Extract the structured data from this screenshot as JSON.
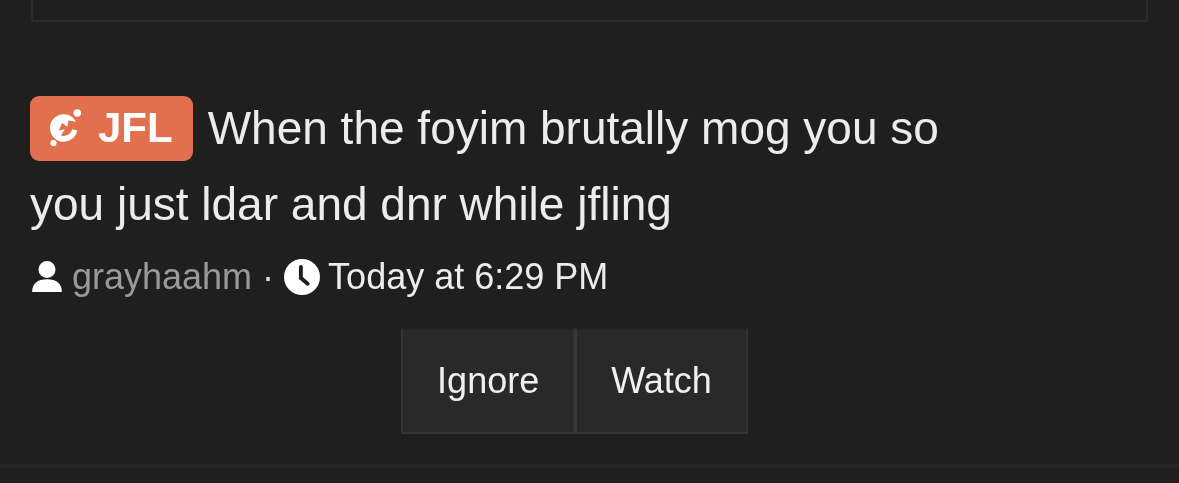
{
  "thread": {
    "prefix": {
      "label": "JFL",
      "color": "#e2704f"
    },
    "title_lines": [
      "When the foyim brutally mog you so",
      "you just ldar and dnr while jfling"
    ],
    "author": "grayhaahm",
    "separator": "·",
    "time": "Today at 6:29 PM",
    "buttons": [
      "Ignore",
      "Watch"
    ]
  }
}
